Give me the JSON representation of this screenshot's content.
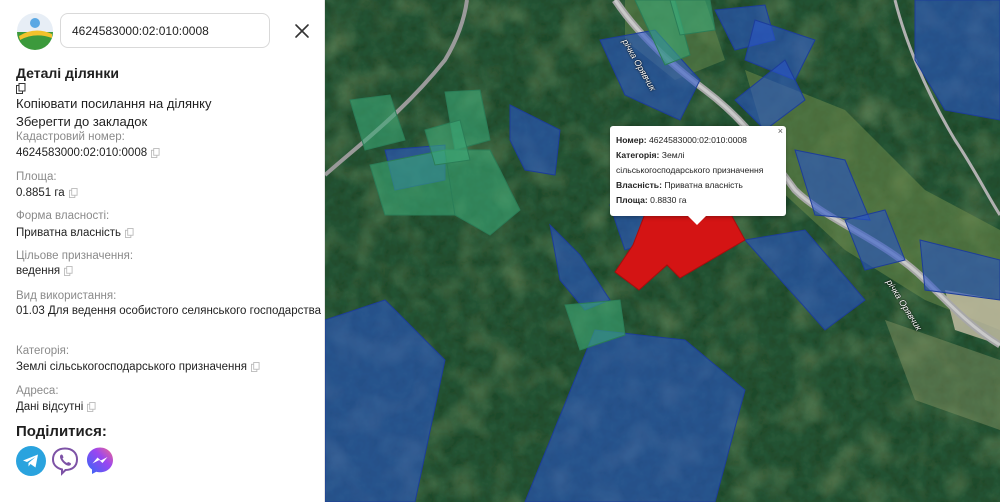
{
  "search": {
    "value": "4624583000:02:010:0008"
  },
  "details": {
    "title": "Деталі ділянки",
    "copy_link": "Копіювати посилання на ділянку",
    "bookmark": "Зберегти до закладок",
    "fields": [
      {
        "label": "Кадастровий номер:",
        "value": "4624583000:02:010:0008"
      },
      {
        "label": "Площа:",
        "value": "0.8851 га"
      },
      {
        "label": "Форма власності:",
        "value": "Приватна власність"
      },
      {
        "label": "Цільове призначення:",
        "value": "ведення"
      },
      {
        "label": "Вид використання:",
        "value": "01.03 Для ведення особистого селянського господарства"
      },
      {
        "label": "Категорія:",
        "value": "Землі сільськогосподарського призначення"
      },
      {
        "label": "Адреса:",
        "value": "Дані відсутні"
      }
    ],
    "share_title": "Поділитися:",
    "share_icons": [
      "telegram-icon",
      "viber-icon",
      "messenger-icon"
    ]
  },
  "popup": {
    "close": "×",
    "rows": [
      {
        "key": "Номер:",
        "value": "4624583000:02:010:0008"
      },
      {
        "key": "Категорія:",
        "value": "Землі"
      },
      {
        "key": "",
        "value": "сільськогосподарського призначення"
      },
      {
        "key": "Власність:",
        "value": "Приватна власність"
      },
      {
        "key": "Площа:",
        "value": "0.8830 га"
      }
    ]
  },
  "map_labels": [
    "річка Орявчик",
    "річка Орявчик"
  ],
  "colors": {
    "selected_parcel": "#d41414",
    "parcel_blue": "#2a55c8",
    "parcel_green": "#3ca876",
    "telegram": "#2aa3de",
    "viber": "#7d52a6",
    "messenger": "#4a6cf7"
  }
}
